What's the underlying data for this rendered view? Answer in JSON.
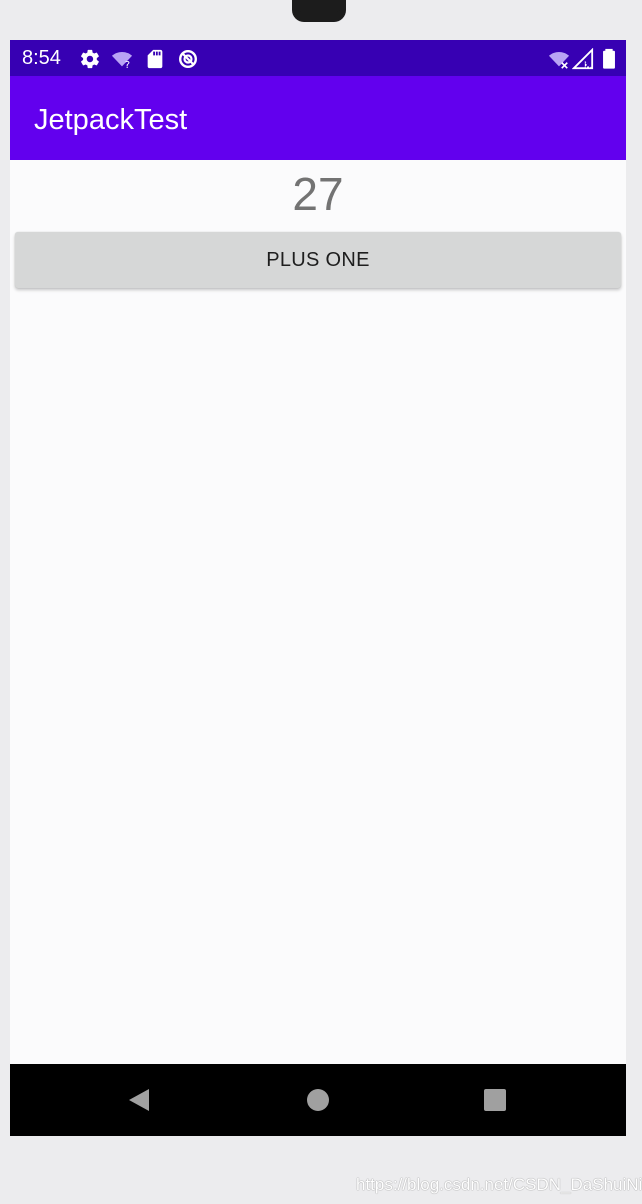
{
  "status_bar": {
    "time": "8:54",
    "icons": [
      "settings-icon",
      "wifi-question-icon",
      "sd-card-icon",
      "data-saver-icon",
      "wifi-off-icon",
      "signal-off-icon",
      "battery-icon"
    ],
    "background_color": "#3700b3"
  },
  "app_bar": {
    "title": "JetpackTest",
    "background_color": "#6200ee"
  },
  "main": {
    "counter_value": "27",
    "plus_one_label": "PLUS ONE"
  },
  "nav_bar": {
    "icons": [
      "back-icon",
      "home-icon",
      "recents-icon"
    ]
  },
  "watermark": "https://blog.csdn.net/CSDN_DaShuiNiu"
}
